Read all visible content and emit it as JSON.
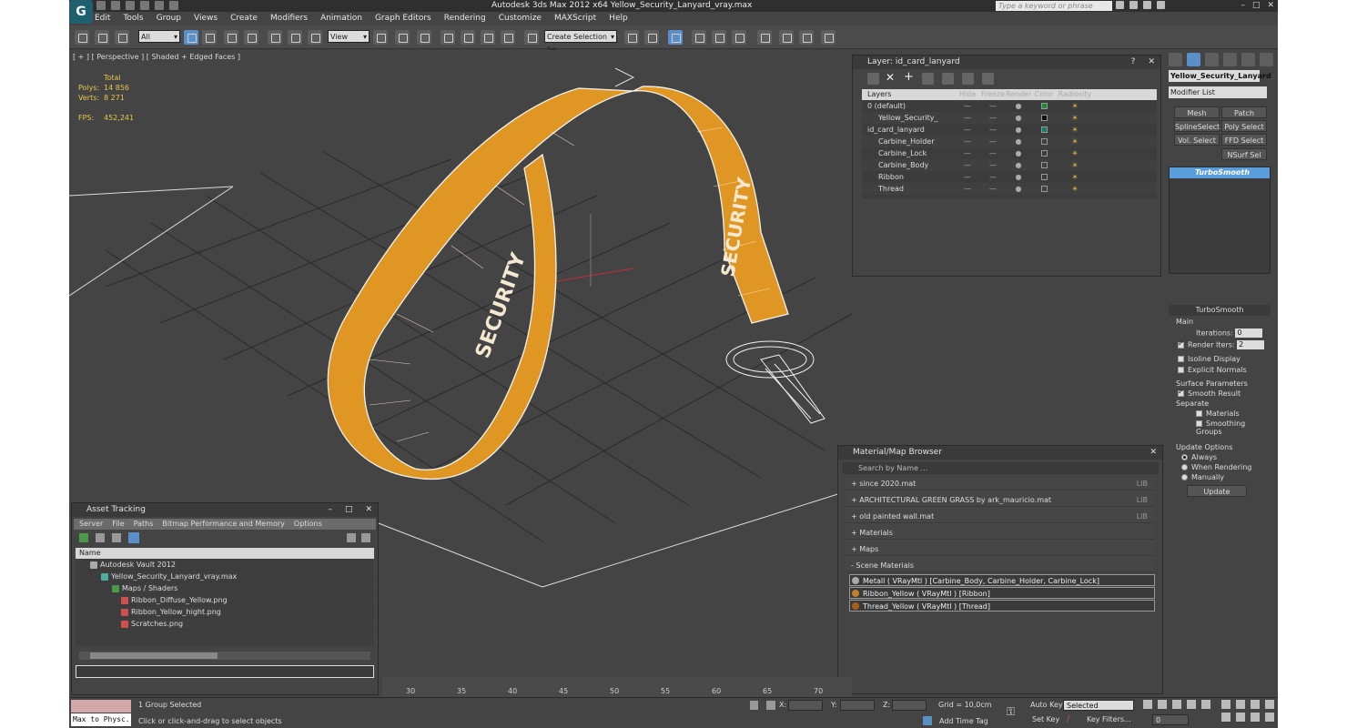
{
  "titlebar": {
    "title": "Autodesk 3ds Max  2012 x64     Yellow_Security_Lanyard_vray.max",
    "search_placeholder": "Type a keyword or phrase"
  },
  "menu": [
    "Edit",
    "Tools",
    "Group",
    "Views",
    "Create",
    "Modifiers",
    "Animation",
    "Graph Editors",
    "Rendering",
    "Customize",
    "MAXScript",
    "Help"
  ],
  "toolbar": {
    "filter_select": "All",
    "ref_coord_select": "View",
    "named_selection_set": "Create Selection Se"
  },
  "viewport": {
    "label": "[ + ] [ Perspective ] [ Shaded + Edged Faces ]",
    "stats_header": "Total",
    "polys_label": "Polys:",
    "polys_value": "14 856",
    "verts_label": "Verts:",
    "verts_value": "8 271",
    "fps_label": "FPS:",
    "fps_value": "452,241",
    "strap_text_1": "SECURITY",
    "strap_text_2": "SECURITY"
  },
  "layer_panel": {
    "title": "Layer: id_card_lanyard",
    "columns": [
      "Layers",
      "Hide",
      "Freeze",
      "Render",
      "Color",
      "Radiosity"
    ],
    "rows": [
      {
        "name": "0 (default)",
        "color": "#1a8a3a"
      },
      {
        "name": "Yellow_Security_",
        "color": "#111111"
      },
      {
        "name": "id_card_lanyard",
        "color": "#1a7a6a"
      },
      {
        "name": "Carbine_Holder",
        "color": "#444444"
      },
      {
        "name": "Carbine_Lock",
        "color": "#444444"
      },
      {
        "name": "Carbine_Body",
        "color": "#444444"
      },
      {
        "name": "Ribbon",
        "color": "#444444"
      },
      {
        "name": "Thread",
        "color": "#444444"
      }
    ]
  },
  "command_panel": {
    "object_name": "Yellow_Security_Lanyard",
    "modifier_list": "Modifier List",
    "buttons": [
      "Mesh Select",
      "Patch Select",
      "SplineSelect",
      "Poly Select",
      "Vol. Select",
      "FFD Select",
      "NSurf Sel"
    ],
    "stack_item": "TurboSmooth",
    "rollout": {
      "title": "TurboSmooth",
      "main": "Main",
      "iterations_label": "Iterations:",
      "iterations_value": "0",
      "render_iters_label": "Render Iters:",
      "render_iters_value": "2",
      "isoline": "Isoline Display",
      "explicit_normals": "Explicit Normals",
      "surface_params": "Surface Parameters",
      "smooth_result": "Smooth Result",
      "separate": "Separate",
      "materials": "Materials",
      "smoothing_groups": "Smoothing Groups",
      "update_options": "Update Options",
      "always": "Always",
      "when_rendering": "When Rendering",
      "manually": "Manually",
      "update_button": "Update"
    }
  },
  "material_browser": {
    "title": "Material/Map Browser",
    "search_placeholder": "Search by Name ...",
    "libraries": [
      {
        "label": "+ since 2020.mat",
        "tag": "LIB"
      },
      {
        "label": "+ ARCHITECTURAL GREEN GRASS by ark_mauricio.mat",
        "tag": "LIB"
      },
      {
        "label": "+ old painted wall.mat",
        "tag": "LIB"
      },
      {
        "label": "+ Materials",
        "tag": ""
      },
      {
        "label": "+ Maps",
        "tag": ""
      },
      {
        "label": "- Scene Materials",
        "tag": ""
      }
    ],
    "scene_materials": [
      "Metall  ( VRayMtl ) [Carbine_Body, Carbine_Holder, Carbine_Lock]",
      "Ribbon_Yellow  ( VRayMtl ) [Ribbon]",
      "Thread_Yellow  ( VRayMtl ) [Thread]"
    ]
  },
  "asset_tracking": {
    "title": "Asset Tracking",
    "menu": [
      "Server",
      "File",
      "Paths",
      "Bitmap Performance and Memory",
      "Options"
    ],
    "column": "Name",
    "rows": [
      {
        "indent": 16,
        "label": "Autodesk Vault 2012"
      },
      {
        "indent": 28,
        "label": "Yellow_Security_Lanyard_vray.max"
      },
      {
        "indent": 40,
        "label": "Maps / Shaders"
      },
      {
        "indent": 50,
        "label": "Ribbon_Diffuse_Yellow.png"
      },
      {
        "indent": 50,
        "label": "Ribbon_Yellow_hight.png"
      },
      {
        "indent": 50,
        "label": "Scratches.png"
      }
    ]
  },
  "timeline": {
    "ticks": [
      "30",
      "35",
      "40",
      "45",
      "50",
      "55",
      "60",
      "65",
      "70"
    ]
  },
  "statusbar": {
    "maxscript": "Max to Physc.",
    "selection": "1 Group Selected",
    "prompt": "Click or click-and-drag to select objects",
    "x_label": "X:",
    "y_label": "Y:",
    "z_label": "Z:",
    "grid": "Grid = 10,0cm",
    "add_time_tag": "Add Time Tag",
    "auto_key": "Auto Key",
    "set_key": "Set Key",
    "selected": "Selected",
    "key_filters": "Key Filters...",
    "frame": "0"
  }
}
